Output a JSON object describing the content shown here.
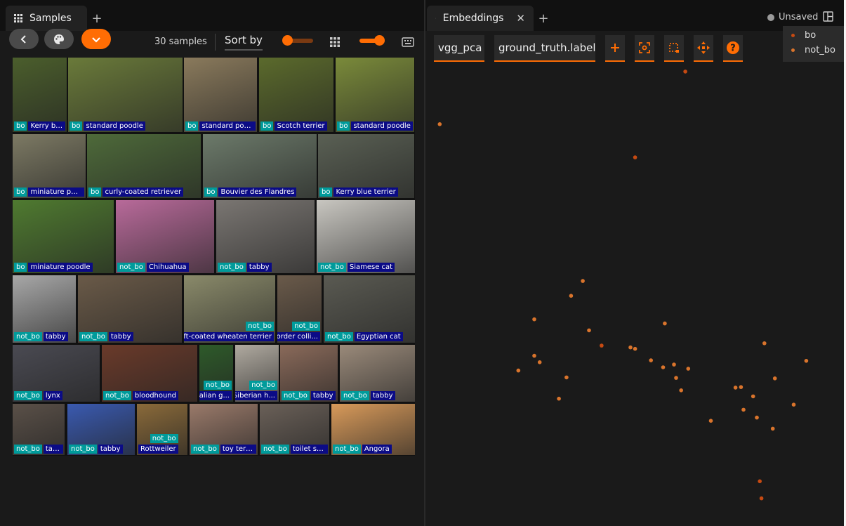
{
  "left_panel": {
    "tab_label": "Samples",
    "sample_count": "30 samples",
    "sort_label": "Sort by"
  },
  "right_panel": {
    "tab_label": "Embeddings",
    "status": "Unsaved",
    "brain_key": "vgg_pca",
    "color_by": "ground_truth.label"
  },
  "colors": {
    "accent": "#ff6d04",
    "gt_badge": "#009b9b",
    "pred_badge": "#0b0b86",
    "bo": "#c64a12",
    "not_bo": "#d9742c"
  },
  "legend": [
    {
      "label": "bo",
      "color": "#c64a12"
    },
    {
      "label": "not_bo",
      "color": "#d9742c"
    }
  ],
  "samples": [
    {
      "gt": "bo",
      "pred": "Kerry blue ter...",
      "bg": "#4b5e2c"
    },
    {
      "gt": "bo",
      "pred": "standard poodle",
      "bg": "#6a7a3a"
    },
    {
      "gt": "bo",
      "pred": "standard poodle",
      "bg": "#8a7a5c"
    },
    {
      "gt": "bo",
      "pred": "Scotch terrier",
      "bg": "#5b6a2c"
    },
    {
      "gt": "bo",
      "pred": "standard poodle",
      "bg": "#7a8a3a"
    },
    {
      "gt": "bo",
      "pred": "miniature poodle",
      "bg": "#7d7a64"
    },
    {
      "gt": "bo",
      "pred": "curly-coated retriever",
      "bg": "#4e6a3a"
    },
    {
      "gt": "bo",
      "pred": "Bouvier des Flandres",
      "bg": "#6c7a6a"
    },
    {
      "gt": "bo",
      "pred": "Kerry blue terrier",
      "bg": "#5a6054"
    },
    {
      "gt": "bo",
      "pred": "miniature poodle",
      "bg": "#4f7a30"
    },
    {
      "gt": "not_bo",
      "pred": "Chihuahua",
      "bg": "#b86a9a"
    },
    {
      "gt": "not_bo",
      "pred": "tabby",
      "bg": "#7a7672"
    },
    {
      "gt": "not_bo",
      "pred": "Siamese cat",
      "bg": "#c8c6c0"
    },
    {
      "gt": "not_bo",
      "pred": "tabby",
      "bg": "#a8a8a8"
    },
    {
      "gt": "not_bo",
      "pred": "tabby",
      "bg": "#6a5a48"
    },
    {
      "gt": "not_bo",
      "pred": "soft-coated wheaten terrier",
      "bg": "#8a8a6a"
    },
    {
      "gt": "not_bo",
      "pred": "Border colli...",
      "bg": "#6a5a4a"
    },
    {
      "gt": "not_bo",
      "pred": "Egyptian cat",
      "bg": "#5a5a52"
    },
    {
      "gt": "not_bo",
      "pred": "lynx",
      "bg": "#4a4a52"
    },
    {
      "gt": "not_bo",
      "pred": "bloodhound",
      "bg": "#6a3a2a"
    },
    {
      "gt": "not_bo",
      "pred": "Italian g...",
      "bg": "#2e5a2a"
    },
    {
      "gt": "not_bo",
      "pred": "Siberian h...",
      "bg": "#b0aaa0"
    },
    {
      "gt": "not_bo",
      "pred": "tabby",
      "bg": "#8a6a5a"
    },
    {
      "gt": "not_bo",
      "pred": "tabby",
      "bg": "#9a8a7a"
    },
    {
      "gt": "not_bo",
      "pred": "tabby",
      "bg": "#5a5048"
    },
    {
      "gt": "not_bo",
      "pred": "tabby",
      "bg": "#3a5ab0"
    },
    {
      "gt": "not_bo",
      "pred": "Rottweiler",
      "bg": "#8a6a3a"
    },
    {
      "gt": "not_bo",
      "pred": "toy terrier",
      "bg": "#9a7a6a"
    },
    {
      "gt": "not_bo",
      "pred": "toilet seat",
      "bg": "#6a6058"
    },
    {
      "gt": "not_bo",
      "pred": "Angora",
      "bg": "#d89a5a"
    }
  ],
  "chart_data": {
    "type": "scatter",
    "x_range": [
      0,
      100
    ],
    "y_range": [
      0,
      100
    ],
    "series": [
      {
        "name": "bo",
        "color": "#c64a12",
        "points": [
          [
            62.1,
            1.5
          ],
          [
            79.9,
            90.3
          ],
          [
            80.3,
            94.0
          ],
          [
            50.1,
            20.1
          ],
          [
            42.1,
            60.9
          ]
        ]
      },
      {
        "name": "not_bo",
        "color": "#d9742c",
        "points": [
          [
            39.1,
            57.6
          ],
          [
            34.8,
            50.1
          ],
          [
            37.6,
            46.9
          ],
          [
            22.2,
            66.3
          ],
          [
            26.0,
            63.1
          ],
          [
            27.3,
            64.5
          ],
          [
            31.9,
            72.4
          ],
          [
            26.0,
            55.2
          ],
          [
            33.7,
            67.8
          ],
          [
            50.1,
            61.6
          ],
          [
            49.0,
            61.3
          ],
          [
            57.2,
            56.1
          ],
          [
            59.9,
            67.9
          ],
          [
            53.9,
            64.1
          ],
          [
            56.8,
            65.6
          ],
          [
            59.4,
            65.0
          ],
          [
            62.8,
            65.9
          ],
          [
            61.1,
            70.6
          ],
          [
            68.2,
            77.2
          ],
          [
            75.4,
            69.9
          ],
          [
            78.3,
            71.9
          ],
          [
            76.0,
            74.8
          ],
          [
            74.1,
            70.0
          ],
          [
            79.2,
            76.5
          ],
          [
            83.0,
            78.9
          ],
          [
            88.0,
            73.7
          ],
          [
            83.5,
            68.0
          ],
          [
            81.0,
            60.4
          ],
          [
            91.0,
            64.2
          ],
          [
            3.4,
            12.9
          ]
        ]
      }
    ]
  }
}
